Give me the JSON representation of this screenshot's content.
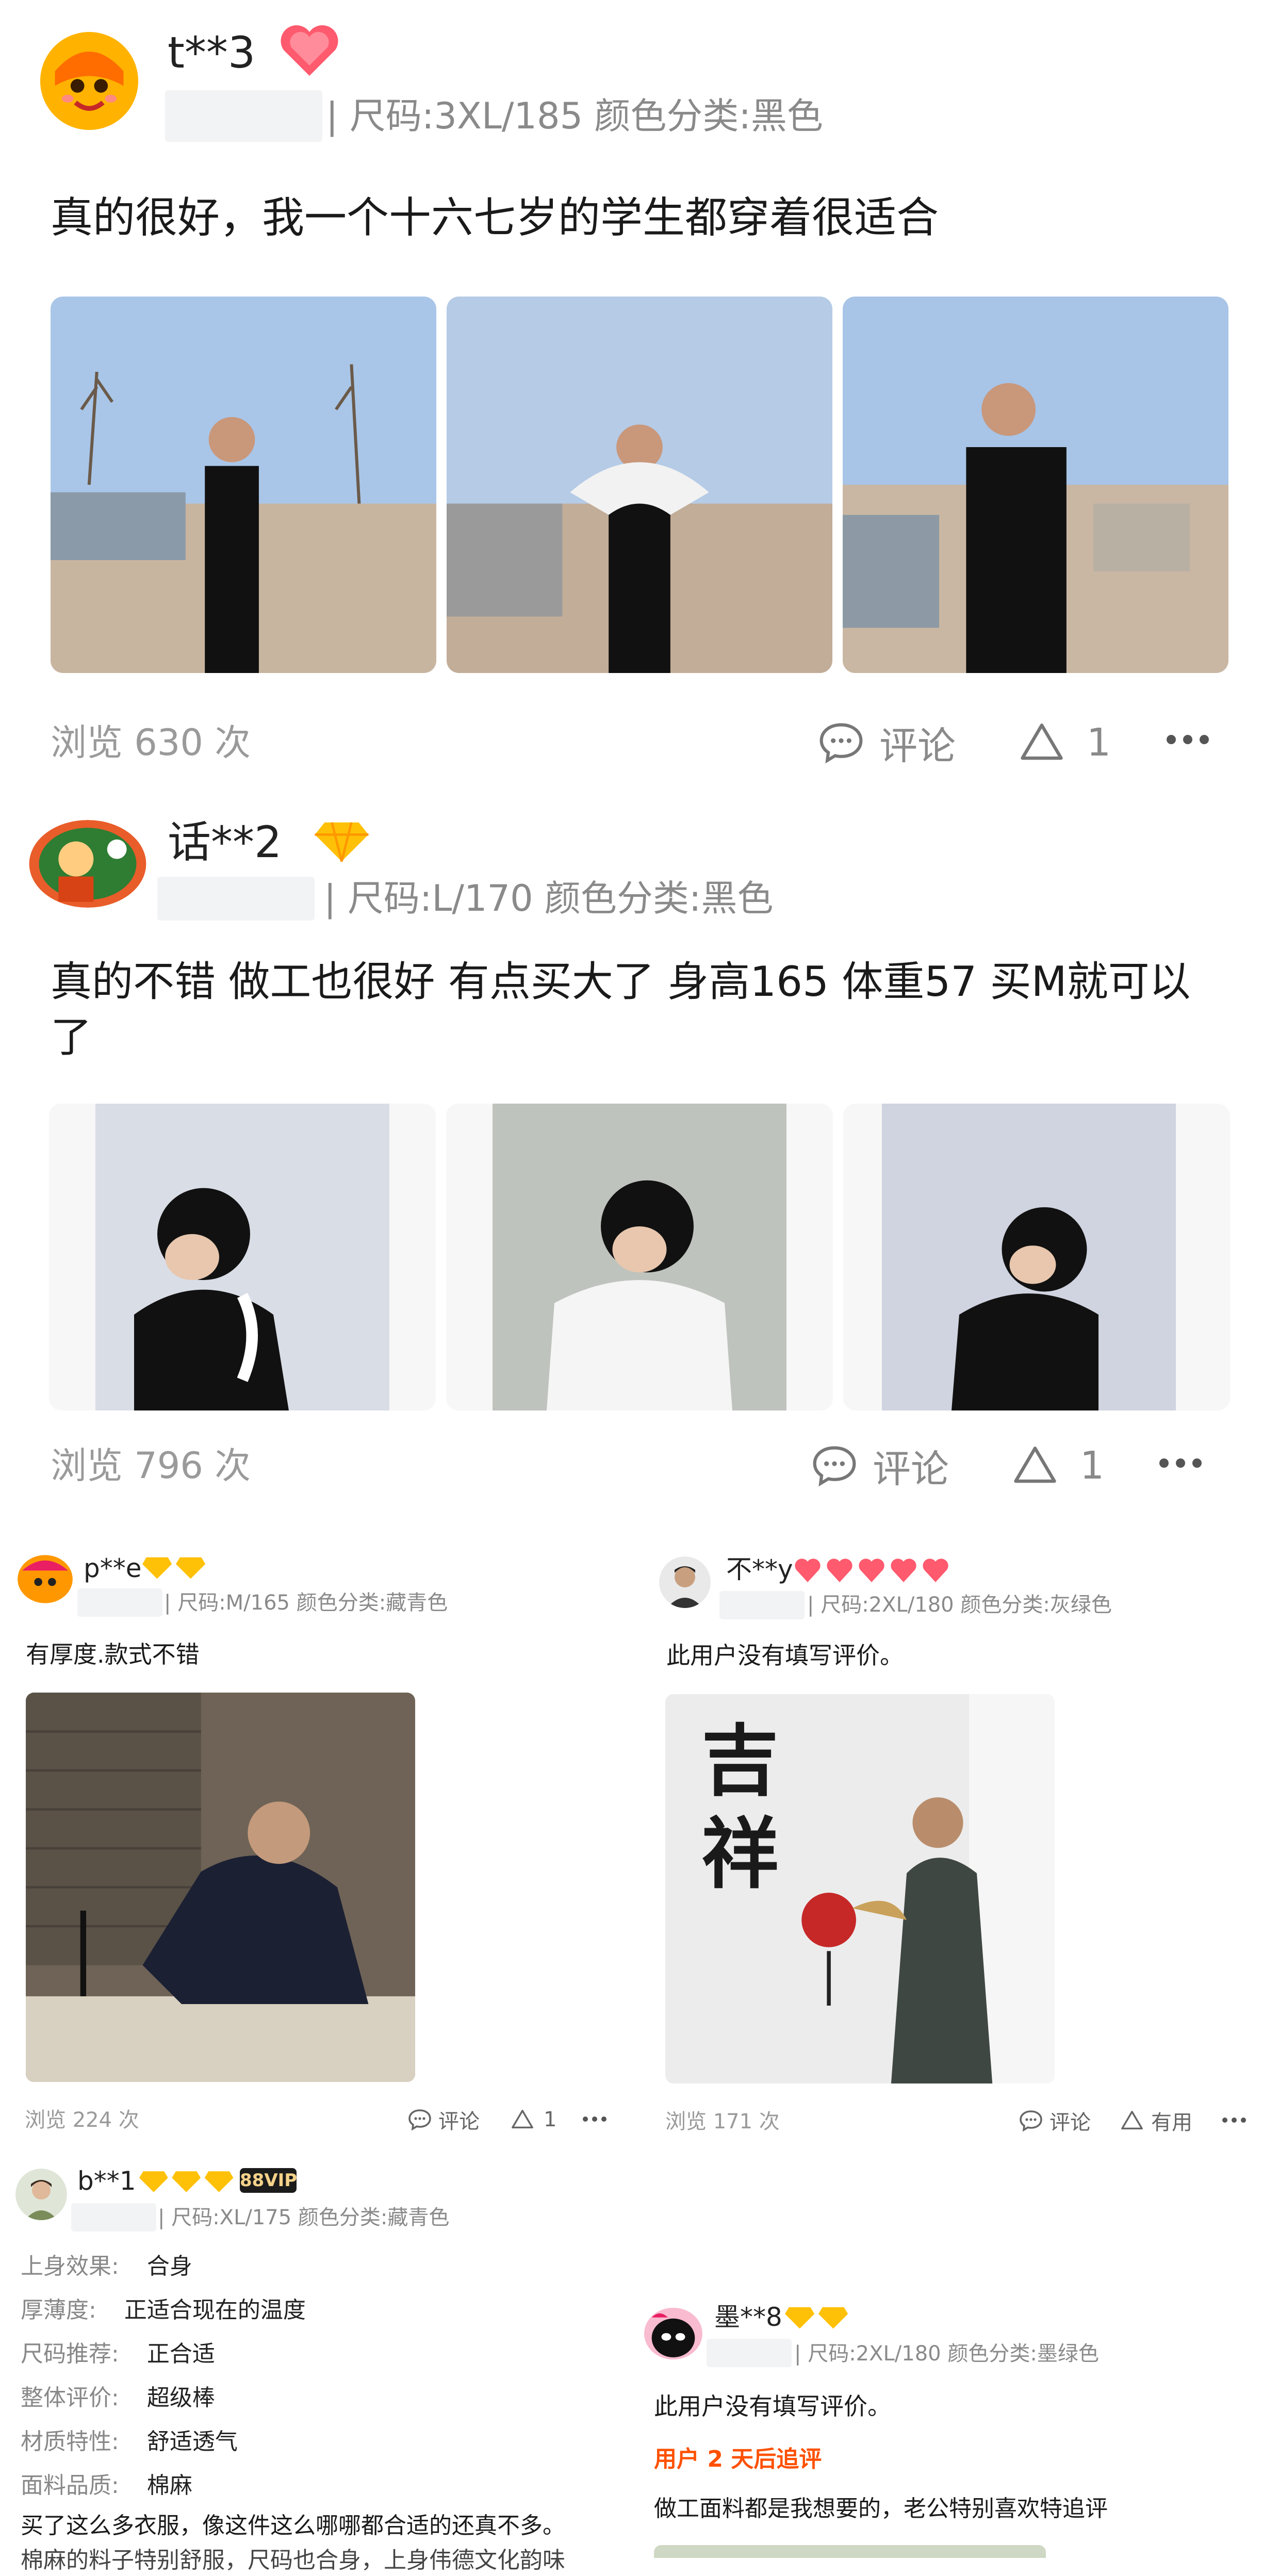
{
  "reviews": [
    {
      "user": "t**3",
      "meta": "| 尺码:3XL/185 颜色分类:黑色",
      "text": "真的很好，我一个十六七岁的学生都穿着很适合",
      "views": "浏览 630 次",
      "comment_label": "评论",
      "like_count": "1"
    },
    {
      "user": "话**2",
      "meta": "| 尺码:L/170 颜色分类:黑色",
      "text": "真的不错 做工也很好 有点买大了 身高165 体重57 买M就可以了",
      "views": "浏览 796 次",
      "comment_label": "评论",
      "like_count": "1"
    },
    {
      "user": "p**e",
      "meta": "| 尺码:M/165 颜色分类:藏青色",
      "text": "有厚度.款式不错",
      "views": "浏览 224 次",
      "comment_label": "评论",
      "like_count": "1"
    },
    {
      "user": "不**y",
      "meta": "| 尺码:2XL/180 颜色分类:灰绿色",
      "text": "此用户没有填写评价。",
      "views": "浏览 171 次",
      "comment_label": "评论",
      "like_label": "有用",
      "poster_text": "吉祥"
    },
    {
      "user": "b**1",
      "badge": "88VIP",
      "meta": "| 尺码:XL/175 颜色分类:藏青色",
      "attributes": [
        {
          "label": "上身效果:",
          "value": "合身"
        },
        {
          "label": "厚薄度:",
          "value": "正适合现在的温度"
        },
        {
          "label": "尺码推荐:",
          "value": "正合适"
        },
        {
          "label": "整体评价:",
          "value": "超级棒"
        },
        {
          "label": "材质特性:",
          "value": "舒适透气"
        },
        {
          "label": "面料品质:",
          "value": "棉麻"
        }
      ],
      "text": "买了这么多衣服，像这件这么哪哪都合适的还真不多。",
      "text2": "棉麻的料子特别舒服，尺码也合身，上身伟德文化韵味"
    },
    {
      "user": "墨**8",
      "meta": "| 尺码:2XL/180 颜色分类:墨绿色",
      "text": "此用户没有填写评价。",
      "followup_label": "用户 2 天后追评",
      "followup_text": "做工面料都是我想要的，老公特别喜欢特追评"
    }
  ]
}
